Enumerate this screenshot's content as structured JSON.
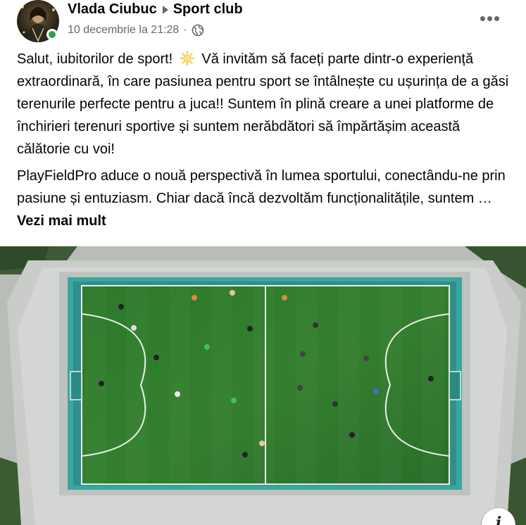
{
  "header": {
    "author": "Vlada Ciubuc",
    "group": "Sport club",
    "timestamp": "10 decembrie la 21:28",
    "separator": "·",
    "privacy_icon": "globe-icon",
    "more_label": "•••"
  },
  "post": {
    "paragraph1_part1": "Salut, iubitorilor de sport!",
    "emoji": "sun-icon",
    "paragraph1_part2": "Vă invităm să faceți parte dintr-o experiență extraordinară, în care pasiunea pentru sport se întâlnește cu ușurința de a găsi terenurile perfecte pentru a juca!! Suntem în plină creare a unei platforme de închirieri terenuri sportive și suntem nerăbdători să împărtășim această călătorie cu voi!",
    "paragraph2": "PlayFieldPro aduce o nouă perspectivă în lumea sportului, conectându-ne prin pasiune și entuziasm. Chiar dacă încă dezvoltăm funcționalitățile, suntem … ",
    "see_more": "Vezi mai mult"
  },
  "image": {
    "subject": "aerial view of football pitch",
    "info_icon": "info-icon",
    "info_label": "i"
  },
  "colors": {
    "text": "#050505",
    "secondary": "#65676b",
    "online": "#31a24c",
    "pitch": "#2f7a2b"
  }
}
